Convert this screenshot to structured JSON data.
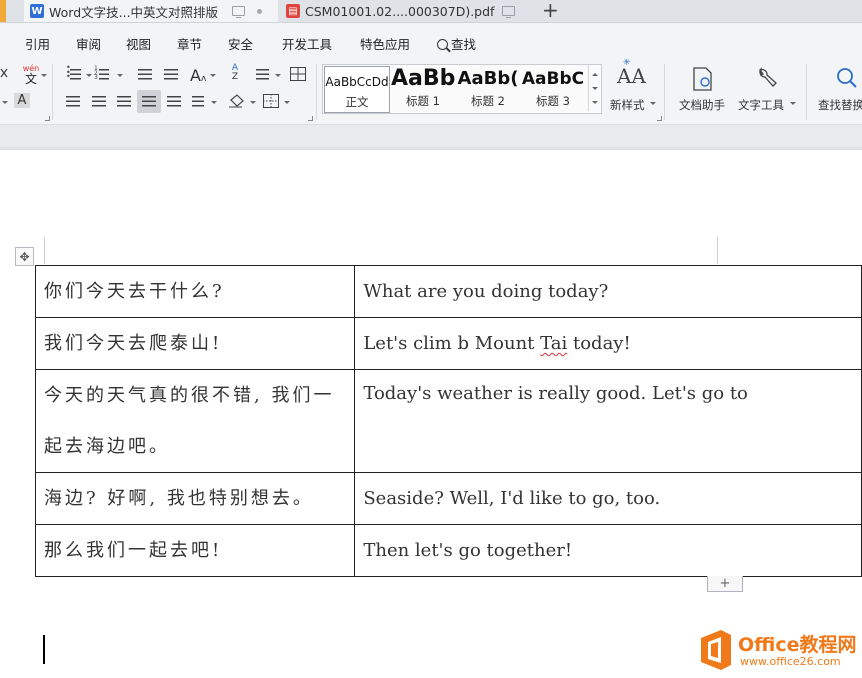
{
  "tabs": [
    {
      "label": "Word文字技...中英文对照排版",
      "icon": "wps-writer-icon",
      "icon_letter": "W",
      "icon_color": "#2f6fd8",
      "active": true
    },
    {
      "label": "CSM01001.02....000307D).pdf",
      "icon": "pdf-icon",
      "icon_color": "#e0443e",
      "active": false
    }
  ],
  "new_tab": "+",
  "menu": [
    "引用",
    "审阅",
    "视图",
    "章节",
    "安全",
    "开发工具",
    "特色应用",
    "查找"
  ],
  "ribbon": {
    "pinyin_label": "wén",
    "pinyin_char": "文",
    "font_char_a": "A",
    "styles": [
      {
        "preview": "AaBbCcDd",
        "caption": "正文"
      },
      {
        "preview": "AaBb",
        "caption": "标题 1"
      },
      {
        "preview": "AaBb(",
        "caption": "标题 2"
      },
      {
        "preview": "AaBbC",
        "caption": "标题 3"
      }
    ],
    "new_style": "新样式",
    "doc_assistant": "文档助手",
    "text_tools": "文字工具",
    "find_replace": "查找替换"
  },
  "table": [
    {
      "zh": "你们今天去干什么?",
      "en": "What are you doing today?"
    },
    {
      "zh": "我们今天去爬泰山!",
      "en_parts": [
        "Let's clim b Mount ",
        "Tai",
        " today!"
      ]
    },
    {
      "zh": "今天的天气真的很不错, 我们一起去海边吧。",
      "en": "Today's weather is really good. Let's go to"
    },
    {
      "zh": "海边? 好啊, 我也特别想去。",
      "en": "Seaside? Well, I'd like to go, too."
    },
    {
      "zh": "那么我们一起去吧!",
      "en": "Then let's go together!"
    }
  ],
  "add_row_label": "+",
  "watermark": {
    "title": "Office教程网",
    "url": "www.office26.com",
    "color": "#f07a1a"
  }
}
